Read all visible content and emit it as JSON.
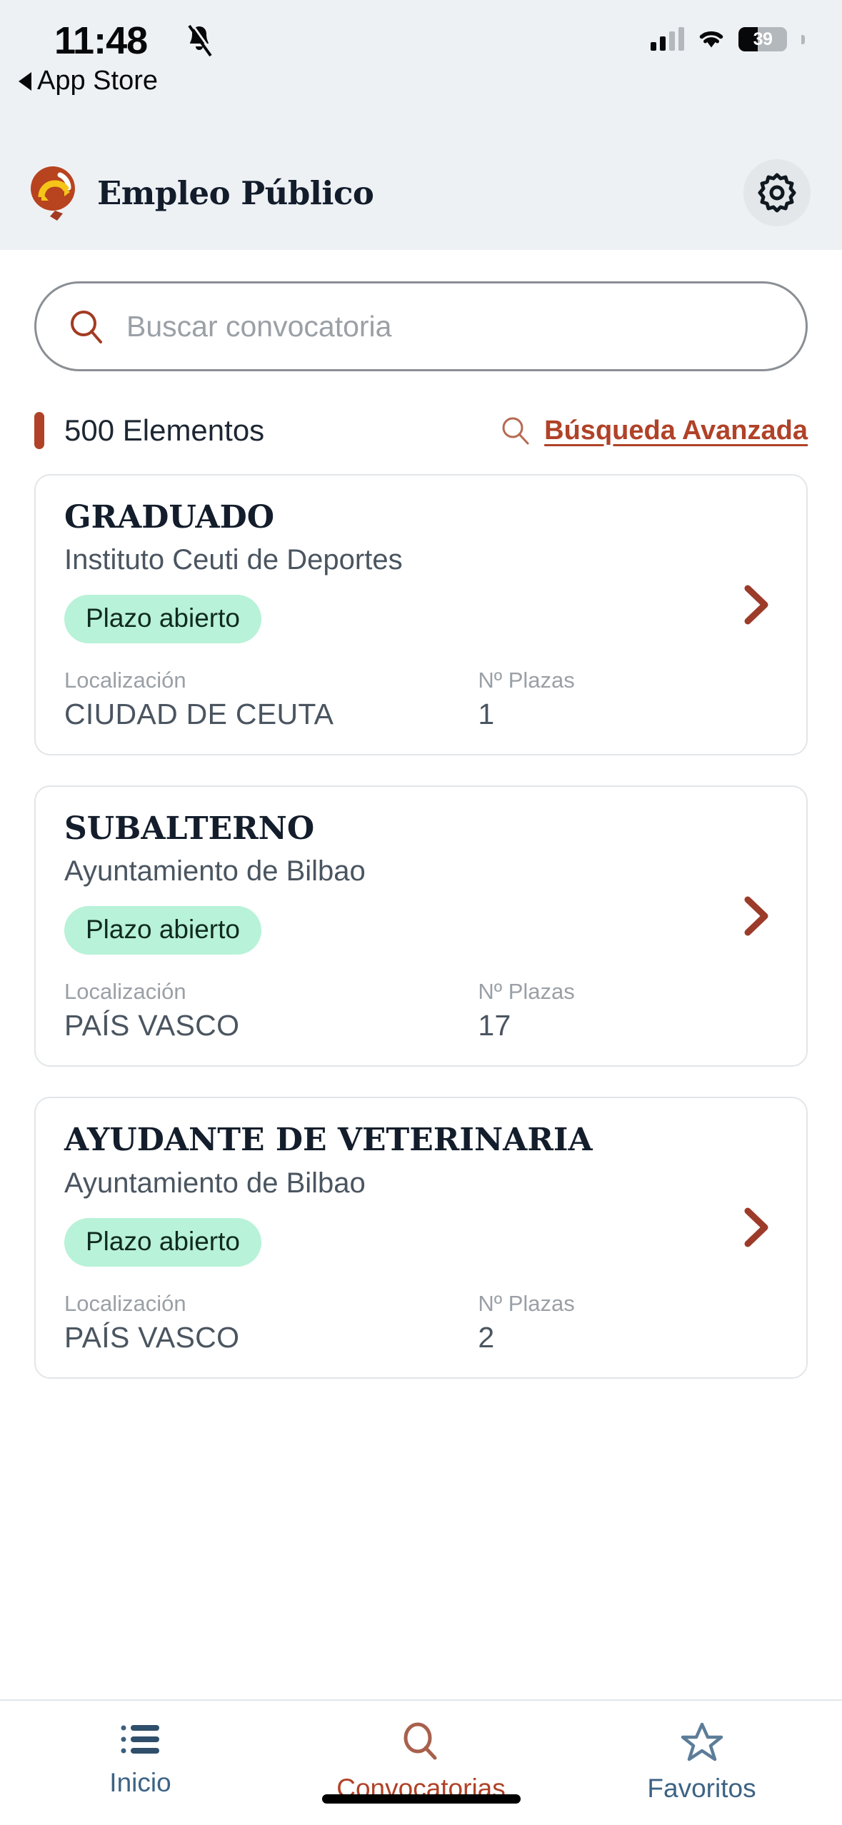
{
  "status_bar": {
    "time": "11:48",
    "back_label": "App Store",
    "back_icon": "triangle-left-icon",
    "mute_icon": "bell-slash-icon",
    "cellular_icon": "cellular-bars-icon",
    "wifi_icon": "wifi-icon",
    "battery_percent": "39"
  },
  "header": {
    "title": "Empleo Público",
    "logo_icon": "magnifier-logo-icon",
    "settings_icon": "gear-icon"
  },
  "search": {
    "placeholder": "Buscar convocatoria",
    "value": "",
    "icon": "search-icon"
  },
  "meta": {
    "count_label": "500 Elementos",
    "advanced_label": "Búsqueda Avanzada",
    "advanced_icon": "search-icon"
  },
  "labels": {
    "localizacion": "Localización",
    "plazas": "Nº Plazas",
    "chevron_icon": "chevron-right-icon"
  },
  "cards": [
    {
      "title": "GRADUADO",
      "org": "Instituto Ceuti de Deportes",
      "status": "Plazo abierto",
      "localizacion": "CIUDAD DE CEUTA",
      "plazas": "1"
    },
    {
      "title": "SUBALTERNO",
      "org": "Ayuntamiento de Bilbao",
      "status": "Plazo abierto",
      "localizacion": "PAÍS VASCO",
      "plazas": "17"
    },
    {
      "title": "AYUDANTE DE VETERINARIA",
      "org": "Ayuntamiento de Bilbao",
      "status": "Plazo abierto",
      "localizacion": "PAÍS VASCO",
      "plazas": "2"
    }
  ],
  "tabs": [
    {
      "label": "Inicio",
      "icon": "list-icon",
      "active": false
    },
    {
      "label": "Convocatorias",
      "icon": "search-icon",
      "active": true
    },
    {
      "label": "Favoritos",
      "icon": "star-icon",
      "active": false
    }
  ],
  "colors": {
    "brand_red": "#b04228",
    "navy": "#131d2b",
    "tab_blue": "#3d6384",
    "badge_green": "#b8f2d8",
    "header_bg": "#eef1f4"
  }
}
